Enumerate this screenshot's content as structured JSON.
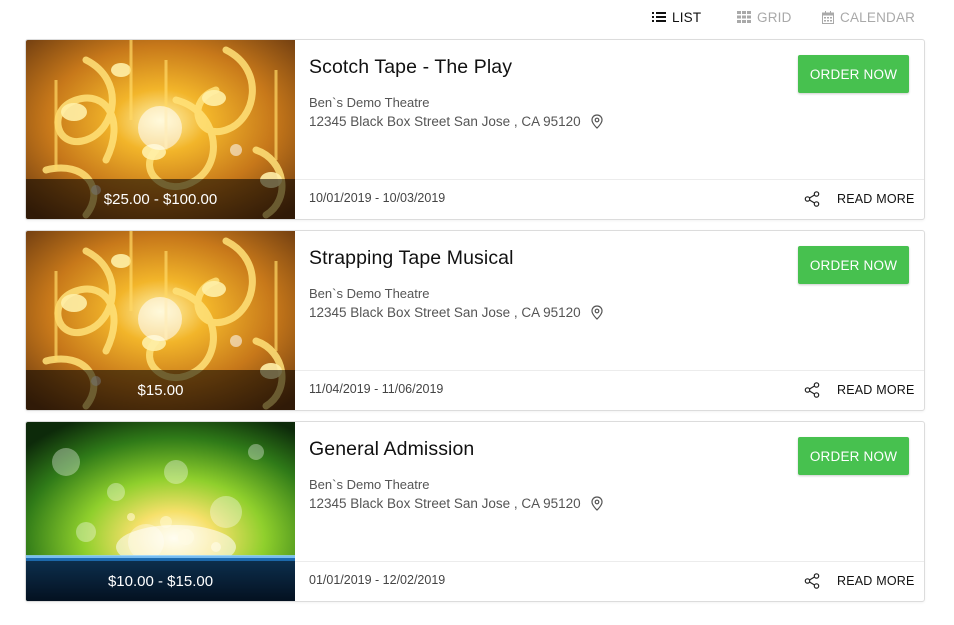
{
  "view_switcher": {
    "options": [
      {
        "label": "LIST",
        "icon": "list-icon",
        "active": true
      },
      {
        "label": "GRID",
        "icon": "grid-icon",
        "active": false
      },
      {
        "label": "CALENDAR",
        "icon": "calendar-icon",
        "active": false
      }
    ]
  },
  "events": [
    {
      "title": "Scotch Tape - The Play",
      "venue": "Ben`s Demo Theatre",
      "address": "12345 Black Box Street San Jose , CA 95120",
      "price": "$25.00 - $100.00",
      "dates": "10/01/2019 - 10/03/2019",
      "order_label": "ORDER NOW",
      "read_more_label": "READ MORE",
      "image": "gold-music-notes"
    },
    {
      "title": "Strapping Tape Musical",
      "venue": "Ben`s Demo Theatre",
      "address": "12345 Black Box Street San Jose , CA 95120",
      "price": "$15.00",
      "dates": "11/04/2019 - 11/06/2019",
      "order_label": "ORDER NOW",
      "read_more_label": "READ MORE",
      "image": "gold-music-notes"
    },
    {
      "title": "General Admission",
      "venue": "Ben`s Demo Theatre",
      "address": "12345 Black Box Street San Jose , CA 95120",
      "price": "$10.00 - $15.00",
      "dates": "01/01/2019 - 12/02/2019",
      "order_label": "ORDER NOW",
      "read_more_label": "READ MORE",
      "image": "green-bokeh-lights"
    }
  ],
  "colors": {
    "order_button": "#47c14f",
    "active_view": "#111111",
    "inactive_view": "#a9a9a9"
  }
}
